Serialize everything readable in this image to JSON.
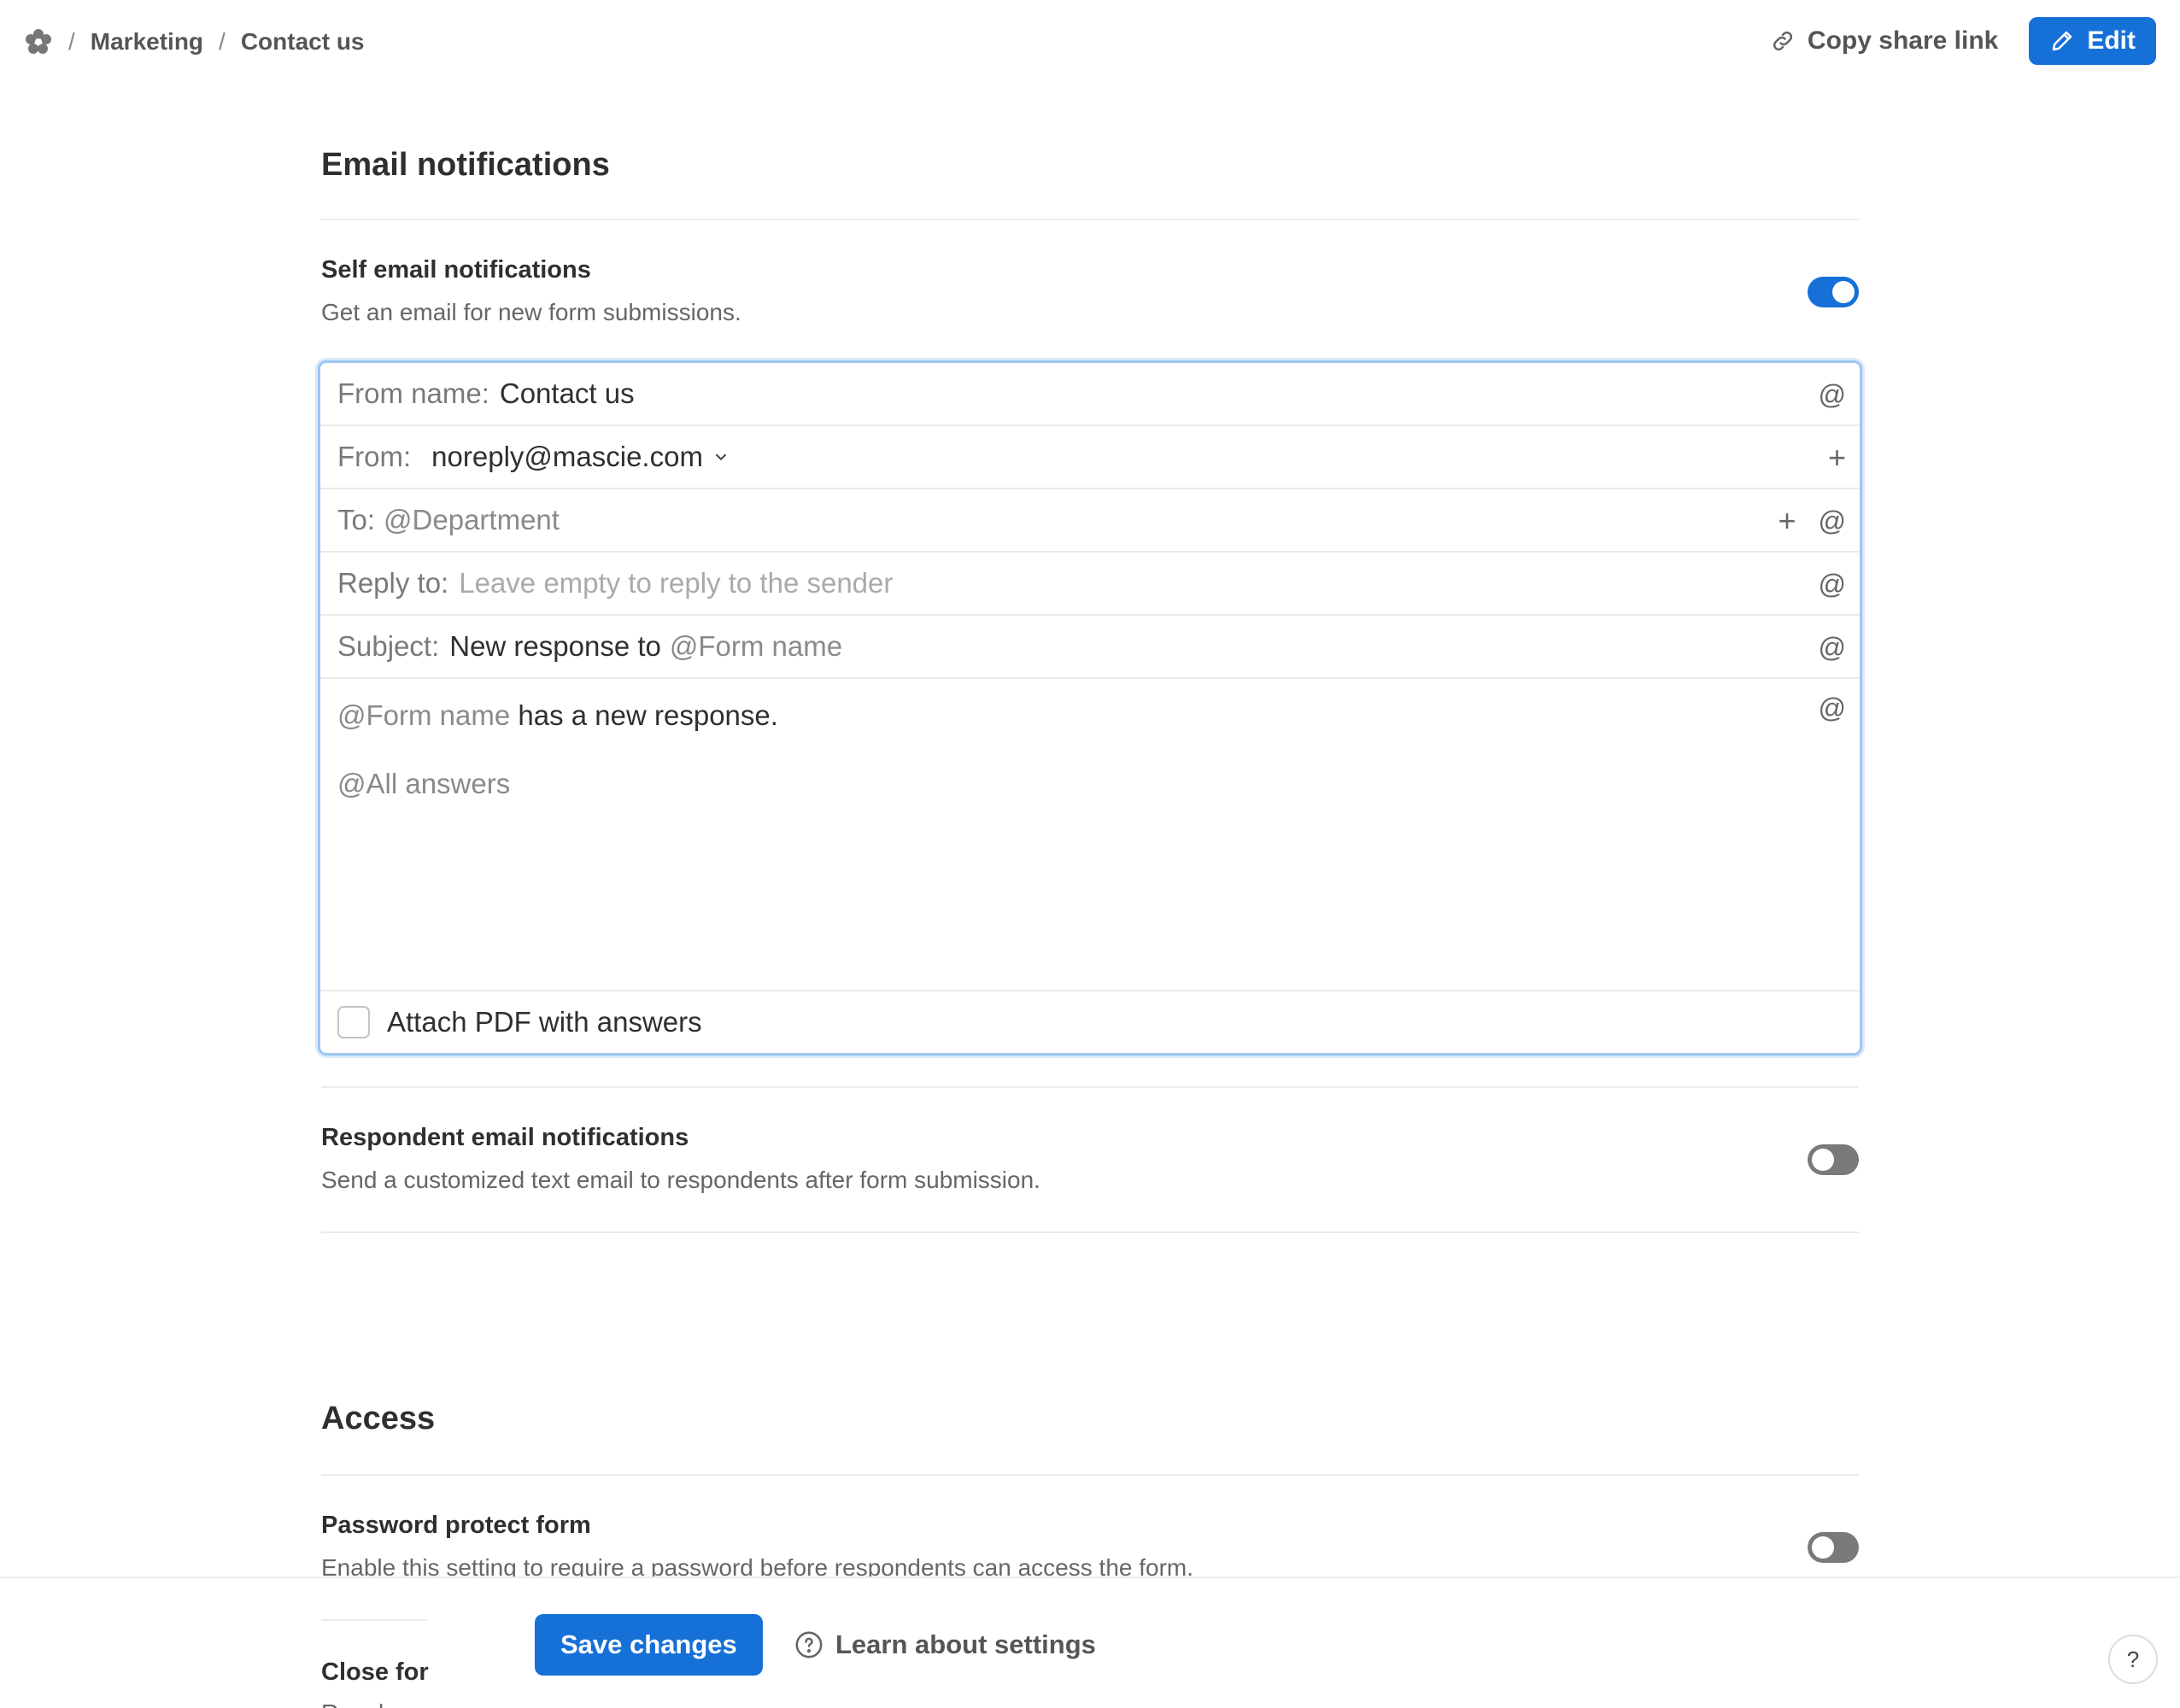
{
  "breadcrumb": {
    "items": [
      "Marketing",
      "Contact us"
    ],
    "separator": "/"
  },
  "header": {
    "copy_share_link": "Copy share link",
    "edit": "Edit"
  },
  "email_notifications": {
    "title": "Email notifications",
    "self": {
      "title": "Self email notifications",
      "description": "Get an email for new form submissions.",
      "enabled": true
    },
    "editor": {
      "from_name_label": "From name:",
      "from_name_value": "Contact us",
      "from_label": "From:",
      "from_value": "noreply@mascie.com",
      "to_label": "To:",
      "to_value": "@Department",
      "reply_to_label": "Reply to:",
      "reply_to_placeholder": "Leave empty to reply to the sender",
      "subject_label": "Subject:",
      "subject_text": "New response to",
      "subject_mention": "@Form name",
      "body_mention": "@Form name",
      "body_text": "has a new response.",
      "body_answers": "@All answers",
      "attach_pdf_label": "Attach PDF with answers",
      "attach_pdf_checked": false
    },
    "respondent": {
      "title": "Respondent email notifications",
      "description": "Send a customized text email to respondents after form submission.",
      "enabled": false
    }
  },
  "access": {
    "title": "Access",
    "password": {
      "title": "Password protect form",
      "description": "Enable this setting to require a password before respondents can access the form.",
      "enabled": false
    },
    "close_for": {
      "title": "Close for",
      "description": "Regula"
    }
  },
  "footer": {
    "save": "Save changes",
    "learn": "Learn about settings",
    "help": "?"
  },
  "colors": {
    "accent": "#1570d8",
    "toggle_off": "#7a7a7a",
    "focus_ring": "#9cc6f2"
  }
}
